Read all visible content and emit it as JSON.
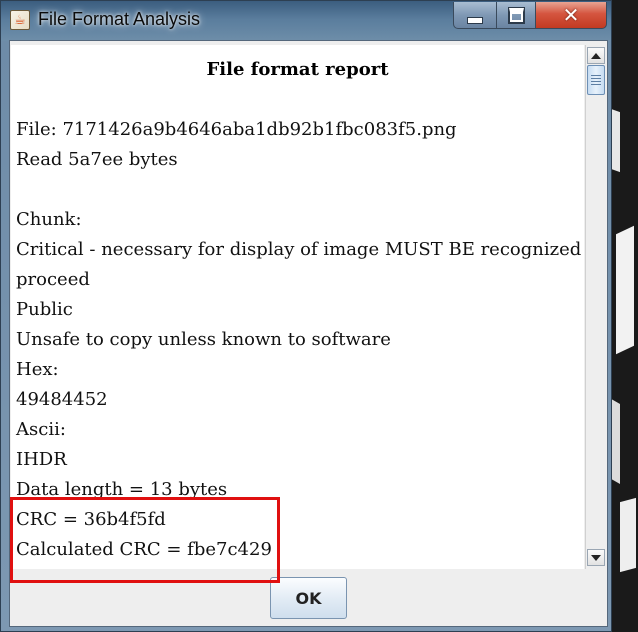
{
  "window": {
    "title": "File Format Analysis",
    "app_icon": "java-cup-icon",
    "controls": {
      "minimize_icon": "minimize-icon",
      "maximize_icon": "maximize-icon",
      "close_icon": "close-icon",
      "close_glyph": "✕"
    }
  },
  "report": {
    "heading": "File format report",
    "lines": [
      "File: 7171426a9b4646aba1db92b1fbc083f5.png",
      "Read 5a7ee bytes",
      "",
      "Chunk:",
      "Critical - necessary for display of image MUST BE recognized to",
      "proceed",
      "Public",
      "Unsafe to copy unless known to software",
      "Hex:",
      "49484452",
      "Ascii:",
      "IHDR",
      "Data length = 13 bytes",
      "CRC = 36b4f5fd",
      "Calculated CRC = fbe7c429"
    ]
  },
  "buttons": {
    "ok_label": "OK"
  },
  "colors": {
    "highlight": "#e01010",
    "close_button": "#c23a22"
  }
}
